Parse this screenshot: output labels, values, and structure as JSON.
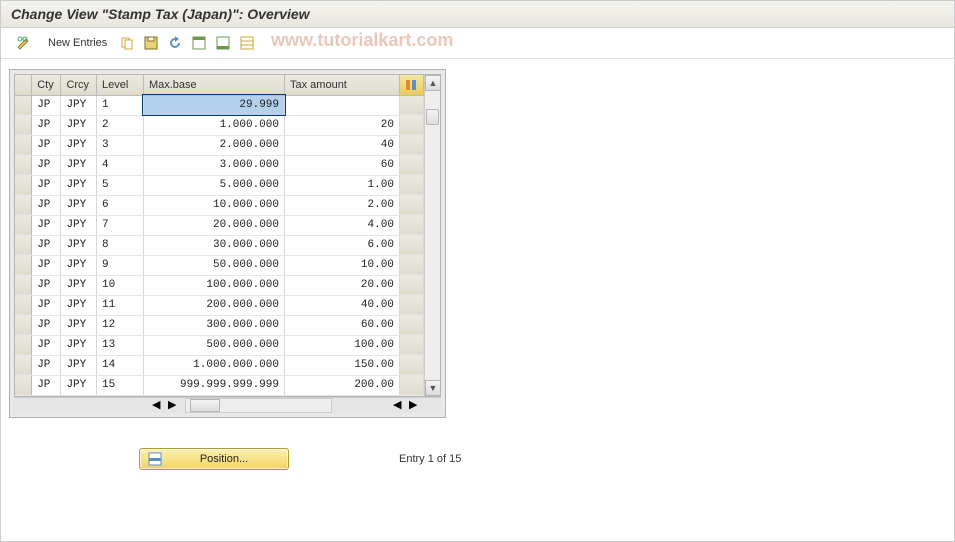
{
  "title": "Change View \"Stamp Tax (Japan)\": Overview",
  "toolbar": {
    "new_entries_label": "New Entries"
  },
  "watermark": "www.tutorialkart.com",
  "columns": {
    "cty": "Cty",
    "crcy": "Crcy",
    "level": "Level",
    "maxbase": "Max.base",
    "taxamount": "Tax amount"
  },
  "rows": [
    {
      "cty": "JP",
      "crcy": "JPY",
      "level": "1",
      "maxbase": "29.999",
      "tax": ""
    },
    {
      "cty": "JP",
      "crcy": "JPY",
      "level": "2",
      "maxbase": "1.000.000",
      "tax": "20"
    },
    {
      "cty": "JP",
      "crcy": "JPY",
      "level": "3",
      "maxbase": "2.000.000",
      "tax": "40"
    },
    {
      "cty": "JP",
      "crcy": "JPY",
      "level": "4",
      "maxbase": "3.000.000",
      "tax": "60"
    },
    {
      "cty": "JP",
      "crcy": "JPY",
      "level": "5",
      "maxbase": "5.000.000",
      "tax": "1.00"
    },
    {
      "cty": "JP",
      "crcy": "JPY",
      "level": "6",
      "maxbase": "10.000.000",
      "tax": "2.00"
    },
    {
      "cty": "JP",
      "crcy": "JPY",
      "level": "7",
      "maxbase": "20.000.000",
      "tax": "4.00"
    },
    {
      "cty": "JP",
      "crcy": "JPY",
      "level": "8",
      "maxbase": "30.000.000",
      "tax": "6.00"
    },
    {
      "cty": "JP",
      "crcy": "JPY",
      "level": "9",
      "maxbase": "50.000.000",
      "tax": "10.00"
    },
    {
      "cty": "JP",
      "crcy": "JPY",
      "level": "10",
      "maxbase": "100.000.000",
      "tax": "20.00"
    },
    {
      "cty": "JP",
      "crcy": "JPY",
      "level": "11",
      "maxbase": "200.000.000",
      "tax": "40.00"
    },
    {
      "cty": "JP",
      "crcy": "JPY",
      "level": "12",
      "maxbase": "300.000.000",
      "tax": "60.00"
    },
    {
      "cty": "JP",
      "crcy": "JPY",
      "level": "13",
      "maxbase": "500.000.000",
      "tax": "100.00"
    },
    {
      "cty": "JP",
      "crcy": "JPY",
      "level": "14",
      "maxbase": "1.000.000.000",
      "tax": "150.00"
    },
    {
      "cty": "JP",
      "crcy": "JPY",
      "level": "15",
      "maxbase": "999.999.999.999",
      "tax": "200.00"
    }
  ],
  "footer": {
    "position_label": "Position...",
    "entry_text": "Entry 1 of 15"
  }
}
